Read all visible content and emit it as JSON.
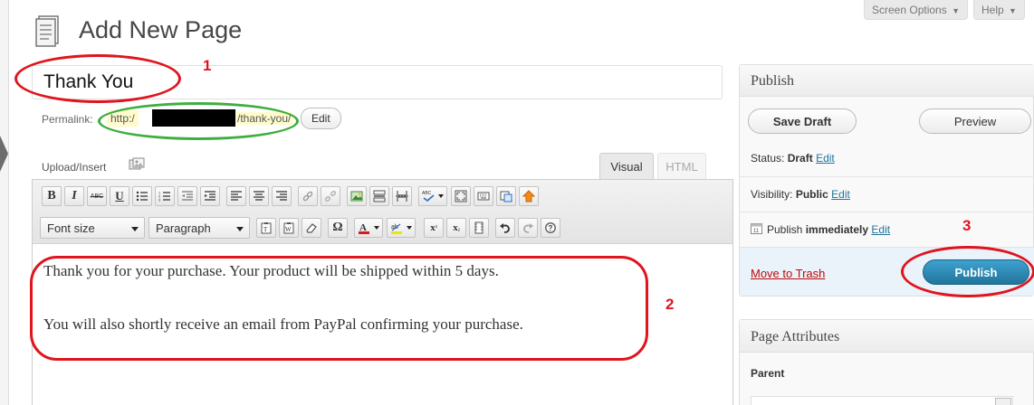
{
  "header": {
    "title": "Add New Page",
    "screen_options_label": "Screen Options",
    "help_label": "Help"
  },
  "post": {
    "title": "Thank You",
    "permalink_label": "Permalink:",
    "permalink_prefix": "http:/",
    "permalink_slug": "/thank-you/",
    "edit_permalink_label": "Edit"
  },
  "editor": {
    "upload_insert_label": "Upload/Insert",
    "tab_visual": "Visual",
    "tab_html": "HTML",
    "font_size_label": "Font size",
    "format_label": "Paragraph",
    "content_lines": [
      "Thank you for your purchase. Your product will be shipped within 5 days.",
      "You will also shortly receive an email from PayPal confirming your purchase."
    ]
  },
  "publish_box": {
    "title": "Publish",
    "save_draft_label": "Save Draft",
    "preview_label": "Preview",
    "status_label": "Status:",
    "status_value": "Draft",
    "visibility_label": "Visibility:",
    "visibility_value": "Public",
    "publish_label": "Publish",
    "publish_time_value": "immediately",
    "edit_label": "Edit",
    "trash_label": "Move to Trash",
    "publish_button_label": "Publish"
  },
  "page_attributes": {
    "title": "Page Attributes",
    "parent_label": "Parent"
  },
  "annotations": {
    "step1": "1",
    "step2": "2",
    "step3": "3"
  },
  "colors": {
    "annotation_red": "#e0141d",
    "annotation_green": "#3fae3f",
    "publish_blue": "#21759b",
    "link_blue": "#21759b",
    "trash_red": "#bc0b0b"
  }
}
